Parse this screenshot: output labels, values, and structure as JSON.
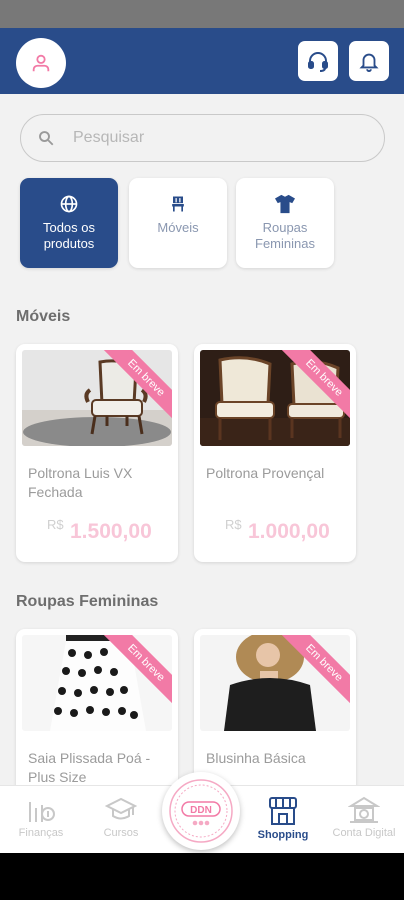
{
  "header": {
    "avatar_icon": "user-icon",
    "support_icon": "headset-icon",
    "notification_icon": "bell-icon",
    "accent": "#294c8a"
  },
  "search": {
    "placeholder": "Pesquisar",
    "value": ""
  },
  "categories": [
    {
      "label": "Todos os produtos",
      "icon": "globe-icon",
      "active": true
    },
    {
      "label": "Móveis",
      "icon": "chair-icon",
      "active": false
    },
    {
      "label": "Roupas Femininas",
      "icon": "shirt-icon",
      "active": false
    }
  ],
  "sections": [
    {
      "title": "Móveis",
      "products": [
        {
          "name": "Poltrona Luis VX Fechada",
          "currency": "R$",
          "price": "1.500,00",
          "badge": "Em breve"
        },
        {
          "name": "Poltrona Provençal",
          "currency": "R$",
          "price": "1.000,00",
          "badge": "Em breve"
        }
      ]
    },
    {
      "title": "Roupas Femininas",
      "products": [
        {
          "name": "Saia Plissada Poá - Plus Size",
          "badge": "Em breve"
        },
        {
          "name": "Blusinha Básica",
          "badge": "Em breve"
        }
      ]
    }
  ],
  "bottom_nav": [
    {
      "label": "Finanças",
      "icon": "finance-chart-icon",
      "active": false
    },
    {
      "label": "Cursos",
      "icon": "graduation-cap-icon",
      "active": false
    },
    {
      "label": "DDN",
      "icon": "ddn-logo",
      "active": false
    },
    {
      "label": "Shopping",
      "icon": "store-icon",
      "active": true
    },
    {
      "label": "Conta Digital",
      "icon": "bank-icon",
      "active": false
    }
  ],
  "badge_color": "#f27aa6",
  "price_color": "#f8c6d8"
}
